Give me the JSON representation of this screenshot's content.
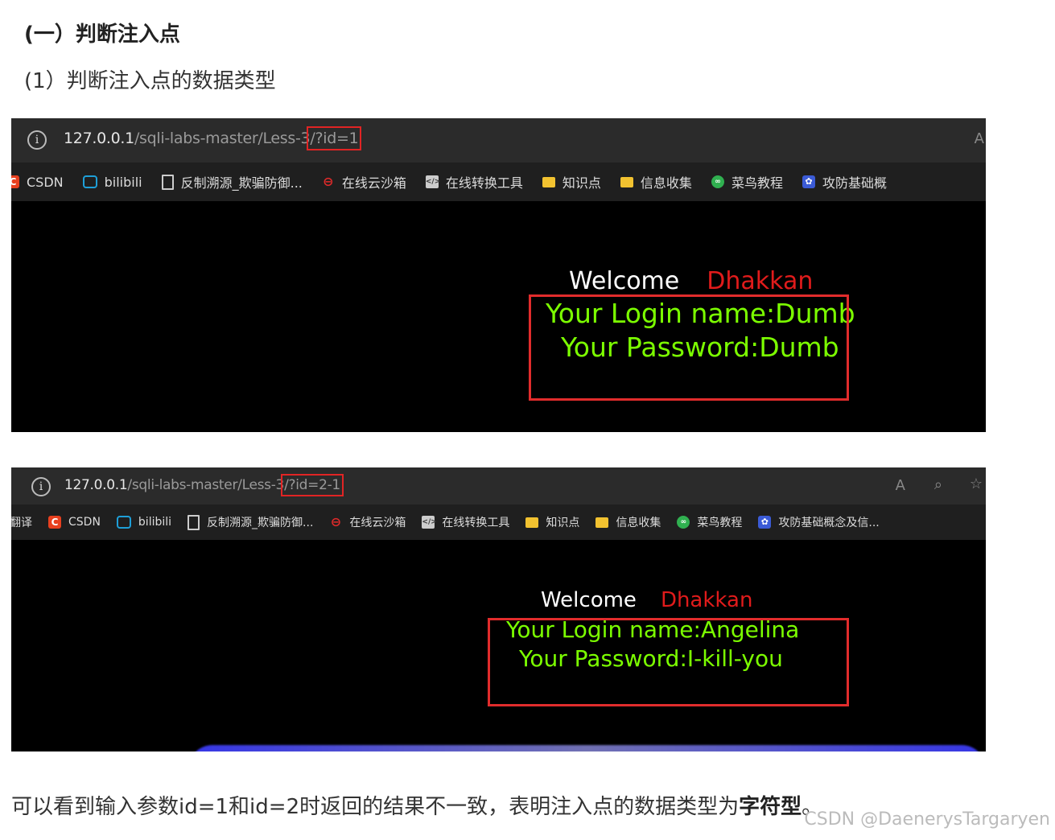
{
  "heading": "(一）判断注入点",
  "subheading": "(1）判断注入点的数据类型",
  "screenshot1": {
    "url_prefix": "127.0.0.1",
    "url_path": "/sqli-labs-master/Less-3",
    "url_query": "/?id=1",
    "bookmarks": [
      {
        "label": "CSDN",
        "icon": "csdn-icon"
      },
      {
        "label": "bilibili",
        "icon": "bilibili-icon"
      },
      {
        "label": "反制溯源_欺骗防御...",
        "icon": "document-icon"
      },
      {
        "label": "在线云沙箱",
        "icon": "sandbox-icon"
      },
      {
        "label": "在线转换工具",
        "icon": "code-icon"
      },
      {
        "label": "知识点",
        "icon": "folder-icon"
      },
      {
        "label": "信息收集",
        "icon": "folder-icon"
      },
      {
        "label": "菜鸟教程",
        "icon": "runoob-icon"
      },
      {
        "label": "攻防基础概",
        "icon": "paw-icon"
      }
    ],
    "welcome": "Welcome",
    "user": "Dhakkan",
    "login_line": "Your Login name:Dumb",
    "password_line": "Your Password:Dumb"
  },
  "screenshot2": {
    "url_prefix": "127.0.0.1",
    "url_path": "/sqli-labs-master/Less-3",
    "url_query": "/?id=2-1",
    "bookmarks": [
      {
        "label": "翻译",
        "icon": "none"
      },
      {
        "label": "CSDN",
        "icon": "csdn-icon"
      },
      {
        "label": "bilibili",
        "icon": "bilibili-icon"
      },
      {
        "label": "反制溯源_欺骗防御...",
        "icon": "document-icon"
      },
      {
        "label": "在线云沙箱",
        "icon": "sandbox-icon"
      },
      {
        "label": "在线转换工具",
        "icon": "code-icon"
      },
      {
        "label": "知识点",
        "icon": "folder-icon"
      },
      {
        "label": "信息收集",
        "icon": "folder-icon"
      },
      {
        "label": "菜鸟教程",
        "icon": "runoob-icon"
      },
      {
        "label": "攻防基础概念及信...",
        "icon": "paw-icon"
      }
    ],
    "welcome": "Welcome",
    "user": "Dhakkan",
    "login_line": "Your Login name:Angelina",
    "password_line": "Your Password:I-kill-you"
  },
  "conclusion_text": "可以看到输入参数id=1和id=2时返回的结果不一致，表明注入点的数据类型为",
  "conclusion_bold": "字符型",
  "conclusion_end": "。",
  "watermark": "CSDN @DaenerysTargaryen"
}
